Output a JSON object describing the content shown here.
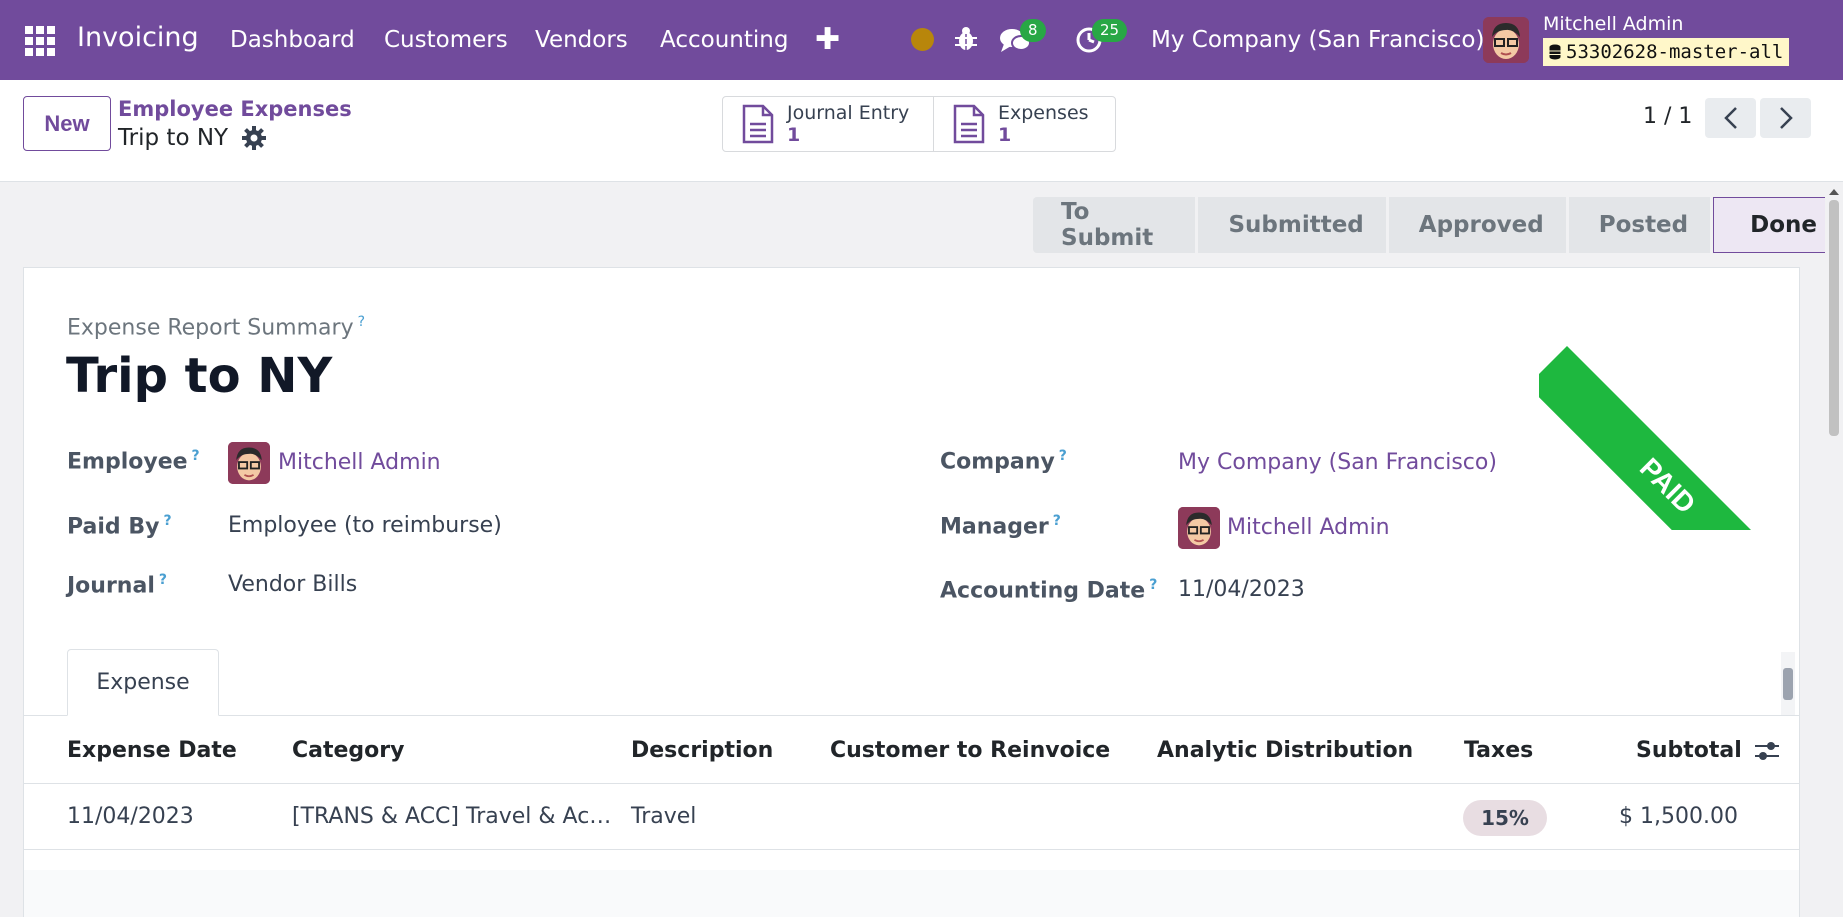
{
  "navbar": {
    "brand": "Invoicing",
    "menu": [
      "Dashboard",
      "Customers",
      "Vendors",
      "Accounting"
    ],
    "chat_badge": "8",
    "activity_badge": "25",
    "company": "My Company (San Francisco)",
    "user_name": "Mitchell Admin",
    "db_name": "53302628-master-all"
  },
  "control_panel": {
    "new_label": "New",
    "breadcrumb_parent": "Employee Expenses",
    "breadcrumb_current": "Trip to NY",
    "smart_buttons": [
      {
        "label": "Journal Entry",
        "value": "1"
      },
      {
        "label": "Expenses",
        "value": "1"
      }
    ],
    "pager": "1 / 1"
  },
  "statusbar": {
    "stages": [
      "To Submit",
      "Submitted",
      "Approved",
      "Posted",
      "Done"
    ],
    "current": "Done"
  },
  "form": {
    "ribbon": "PAID",
    "title_label": "Expense Report Summary",
    "title": "Trip to NY",
    "fields_left": [
      {
        "label": "Employee",
        "value": "Mitchell Admin"
      },
      {
        "label": "Paid By",
        "value": "Employee (to reimburse)"
      },
      {
        "label": "Journal",
        "value": "Vendor Bills"
      }
    ],
    "fields_right": [
      {
        "label": "Company",
        "value": "My Company (San Francisco)"
      },
      {
        "label": "Manager",
        "value": "Mitchell Admin"
      },
      {
        "label": "Accounting Date",
        "value": "11/04/2023"
      }
    ],
    "help_mark": "?"
  },
  "notebook": {
    "tab": "Expense",
    "columns": [
      "Expense Date",
      "Category",
      "Description",
      "Customer to Reinvoice",
      "Analytic Distribution",
      "Taxes",
      "Subtotal"
    ],
    "rows": [
      {
        "expense_date": "11/04/2023",
        "category": "[TRANS & ACC] Travel & Ac…",
        "description": "Travel",
        "customer": "",
        "analytic": "",
        "taxes": "15%",
        "subtotal": "$ 1,500.00"
      }
    ]
  },
  "colors": {
    "brand": "#714b9c",
    "paid_ribbon": "#1eb83f",
    "badge": "#28a745"
  }
}
